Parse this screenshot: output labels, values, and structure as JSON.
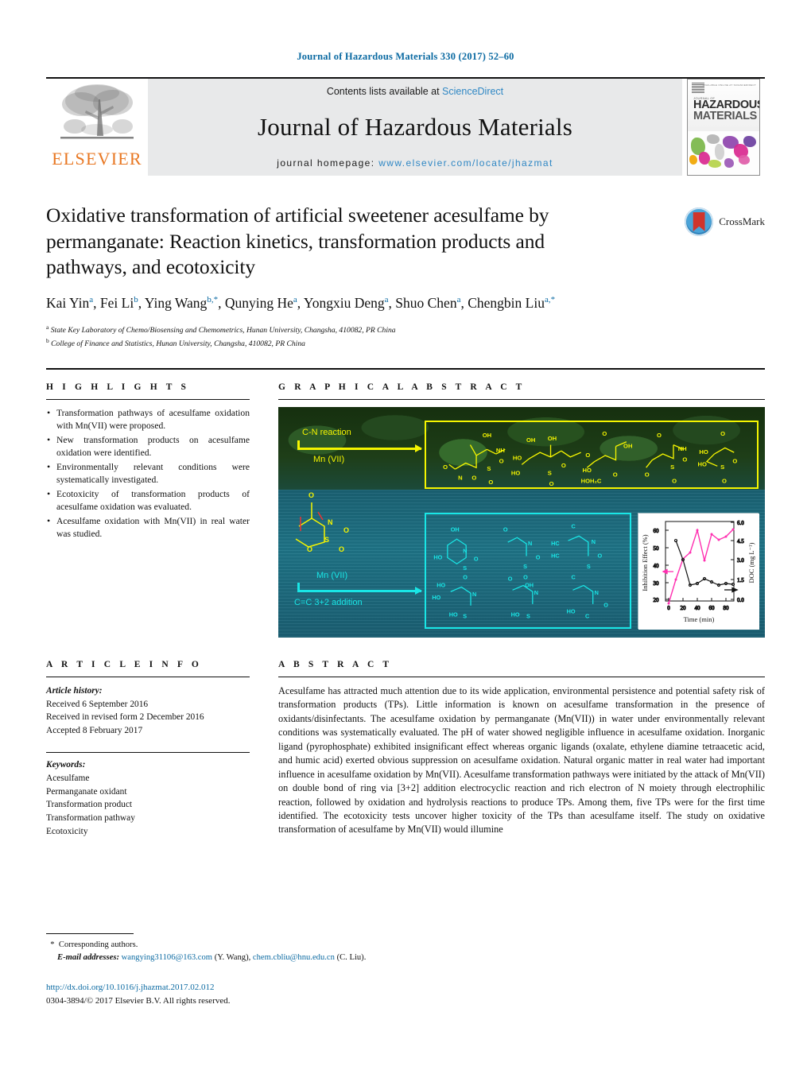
{
  "running_head": "Journal of Hazardous Materials 330 (2017) 52–60",
  "masthead": {
    "publisher_name": "ELSEVIER",
    "contents_prefix": "Contents lists available at ",
    "contents_link": "ScienceDirect",
    "journal_title": "Journal of Hazardous Materials",
    "homepage_prefix": "journal homepage: ",
    "homepage_url": "www.elsevier.com/locate/jhazmat",
    "cover": {
      "line1": "HAZARDOUS",
      "line2": "MATERIALS",
      "kicker": "JOURNAL OF",
      "tagline": "AVAILABLE ONLINE AT SCIENCEDIRECT"
    }
  },
  "crossmark": {
    "label": "CrossMark"
  },
  "article": {
    "title": "Oxidative transformation of artificial sweetener acesulfame by permanganate: Reaction kinetics, transformation products and pathways, and ecotoxicity",
    "authors": [
      {
        "name": "Kai Yin",
        "marks": "a"
      },
      {
        "name": "Fei Li",
        "marks": "b"
      },
      {
        "name": "Ying Wang",
        "marks": "b,*"
      },
      {
        "name": "Qunying He",
        "marks": "a"
      },
      {
        "name": "Yongxiu Deng",
        "marks": "a"
      },
      {
        "name": "Shuo Chen",
        "marks": "a"
      },
      {
        "name": "Chengbin Liu",
        "marks": "a,*"
      }
    ],
    "affiliations": [
      {
        "mark": "a",
        "text": "State Key Laboratory of Chemo/Biosensing and Chemometrics, Hunan University, Changsha, 410082, PR China"
      },
      {
        "mark": "b",
        "text": "College of Finance and Statistics, Hunan University, Changsha, 410082, PR China"
      }
    ]
  },
  "highlights": {
    "heading": "H I G H L I G H T S",
    "items": [
      "Transformation pathways of acesulfame oxidation with Mn(VII) were proposed.",
      "New transformation products on acesulfame oxidation were identified.",
      "Environmentally relevant conditions were systematically investigated.",
      "Ecotoxicity of transformation products of acesulfame oxidation was evaluated.",
      "Acesulfame oxidation with Mn(VII) in real water was studied."
    ]
  },
  "graphical_abstract": {
    "heading": "G R A P H I C A L   A B S T R A C T",
    "labels": {
      "pathway_top_title": "C-N  reaction",
      "pathway_top_reagent": "Mn (VII)",
      "pathway_bottom_reagent": "Mn (VII)",
      "pathway_bottom_title": "C=C 3+2 addition"
    },
    "chart_data": {
      "type": "line",
      "title": "",
      "xlabel": "Time (min)",
      "ylabel": "Inhibition Effect (%)",
      "y2label": "DOC (mg L-1)",
      "xlim": [
        0,
        95
      ],
      "ylim": [
        15,
        63
      ],
      "y2lim": [
        0.0,
        6.0
      ],
      "xticks": [
        0,
        20,
        40,
        60,
        80
      ],
      "yticks": [
        20,
        30,
        40,
        50,
        60
      ],
      "y2ticks": [
        "0.0",
        "1.5",
        "3.0",
        "4.5",
        "6.0"
      ],
      "grid": false,
      "legend": "none",
      "series": [
        {
          "name": "Inhibition Effect (%)",
          "color": "#ff2fb0",
          "axis": "left",
          "x": [
            0,
            10,
            20,
            30,
            40,
            50,
            60,
            70,
            80,
            90
          ],
          "y": [
            18.5,
            32.0,
            45.5,
            49.5,
            60.0,
            44.5,
            57.5,
            54.5,
            56.5,
            60.5
          ]
        },
        {
          "name": "DOC (mg L-1)",
          "color": "#111111",
          "axis": "right",
          "x": [
            10,
            20,
            30,
            40,
            50,
            60,
            70,
            80,
            90
          ],
          "y": [
            4.45,
            2.95,
            1.05,
            1.2,
            1.55,
            1.3,
            1.05,
            1.15,
            1.1
          ]
        }
      ]
    }
  },
  "article_info": {
    "heading": "A R T I C L E   I N F O",
    "history_label": "Article history:",
    "history": [
      "Received 6 September 2016",
      "Received in revised form 2 December 2016",
      "Accepted 8 February 2017"
    ],
    "keywords_label": "Keywords:",
    "keywords": [
      "Acesulfame",
      "Permanganate oxidant",
      "Transformation product",
      "Transformation pathway",
      "Ecotoxicity"
    ]
  },
  "abstract": {
    "heading": "A B S T R A C T",
    "text": "Acesulfame has attracted much attention due to its wide application, environmental persistence and potential safety risk of transformation products (TPs). Little information is known on acesulfame transformation in the presence of oxidants/disinfectants. The acesulfame oxidation by permanganate (Mn(VII)) in water under environmentally relevant conditions was systematically evaluated. The pH of water showed negligible influence in acesulfame oxidation. Inorganic ligand (pyrophosphate) exhibited insignificant effect whereas organic ligands (oxalate, ethylene diamine tetraacetic acid, and humic acid) exerted obvious suppression on acesulfame oxidation. Natural organic matter in real water had important influence in acesulfame oxidation by Mn(VII). Acesulfame transformation pathways were initiated by the attack of Mn(VII) on double bond of ring via [3+2] addition electrocyclic reaction and rich electron of N moiety through electrophilic reaction, followed by oxidation and hydrolysis reactions to produce TPs. Among them, five TPs were for the first time identified. The ecotoxicity tests uncover higher toxicity of the TPs than acesulfame itself. The study on oxidative transformation of acesulfame by Mn(VII) would illumine"
  },
  "footer": {
    "corresponding": "Corresponding authors.",
    "email_label": "E-mail addresses:",
    "email1": "wangying31106@163.com",
    "email1_owner": "(Y. Wang),",
    "email2": "chem.cbliu@hnu.edu.cn",
    "email2_owner": "(C. Liu).",
    "doi": "http://dx.doi.org/10.1016/j.jhazmat.2017.02.012",
    "copyright": "0304-3894/© 2017 Elsevier B.V. All rights reserved."
  },
  "colors": {
    "link": "#0b6aa2",
    "elsevier_orange": "#E87722",
    "yellow_path": "#f5f500",
    "cyan_path": "#19e6e6",
    "magenta_series": "#ff2fb0"
  }
}
